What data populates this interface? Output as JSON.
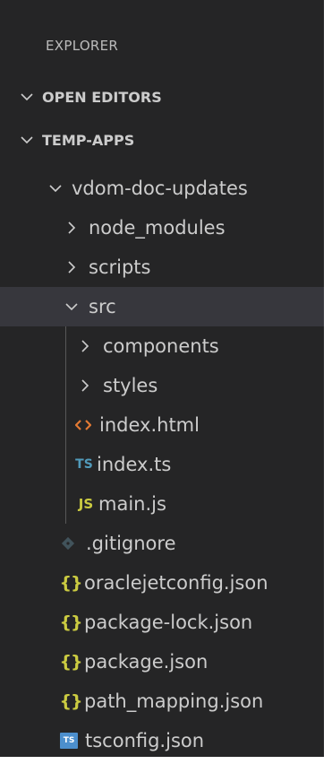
{
  "explorer": {
    "title": "EXPLORER"
  },
  "sections": {
    "open_editors": "OPEN EDITORS",
    "workspace": "TEMP-APPS"
  },
  "tree": {
    "root_folder": "vdom-doc-updates",
    "node_modules": "node_modules",
    "scripts": "scripts",
    "src": "src",
    "components": "components",
    "styles": "styles",
    "index_html": "index.html",
    "index_ts": "index.ts",
    "main_js": "main.js",
    "gitignore": ".gitignore",
    "oraclejetconfig": "oraclejetconfig.json",
    "package_lock": "package-lock.json",
    "package_json": "package.json",
    "path_mapping": "path_mapping.json",
    "tsconfig": "tsconfig.json"
  },
  "icons": {
    "json_glyph": "{}",
    "ts_glyph": "TS",
    "js_glyph": "JS",
    "tsconfig_glyph": "TS",
    "html_glyph": "<>"
  },
  "colors": {
    "panel_bg": "#252526",
    "selected_row": "#37373d",
    "html_icon": "#e37933",
    "ts_icon": "#519aba",
    "js_icon": "#cbcb41",
    "json_icon": "#cbcb41",
    "gitignore_icon": "#41535b"
  }
}
